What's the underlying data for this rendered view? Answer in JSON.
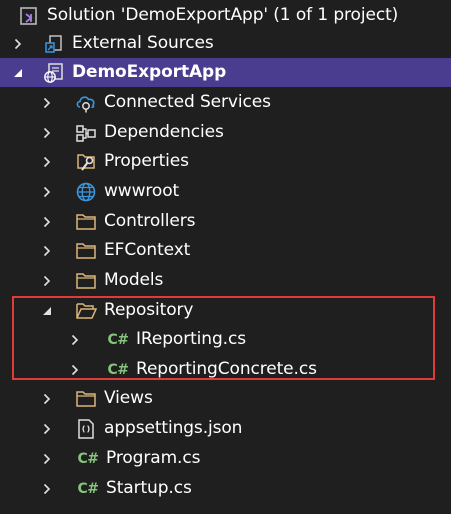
{
  "solution": {
    "label": "Solution 'DemoExportApp' (1 of 1 project)"
  },
  "items": {
    "external_sources": "External Sources",
    "project": "DemoExportApp",
    "connected_services": "Connected Services",
    "dependencies": "Dependencies",
    "properties": "Properties",
    "wwwroot": "wwwroot",
    "controllers": "Controllers",
    "efcontext": "EFContext",
    "models": "Models",
    "repository": "Repository",
    "ireporting": "IReporting.cs",
    "reporting_concrete": "ReportingConcrete.cs",
    "views": "Views",
    "appsettings": "appsettings.json",
    "program": "Program.cs",
    "startup": "Startup.cs"
  },
  "icons": {
    "csharp_glyph": "C#"
  },
  "colors": {
    "background": "#1f1f1f",
    "selection": "#4a3c8f",
    "highlight_border": "#e03b3b",
    "csharp": "#86c37d",
    "folder": "#dcb67a",
    "globe": "#3a96dd"
  }
}
